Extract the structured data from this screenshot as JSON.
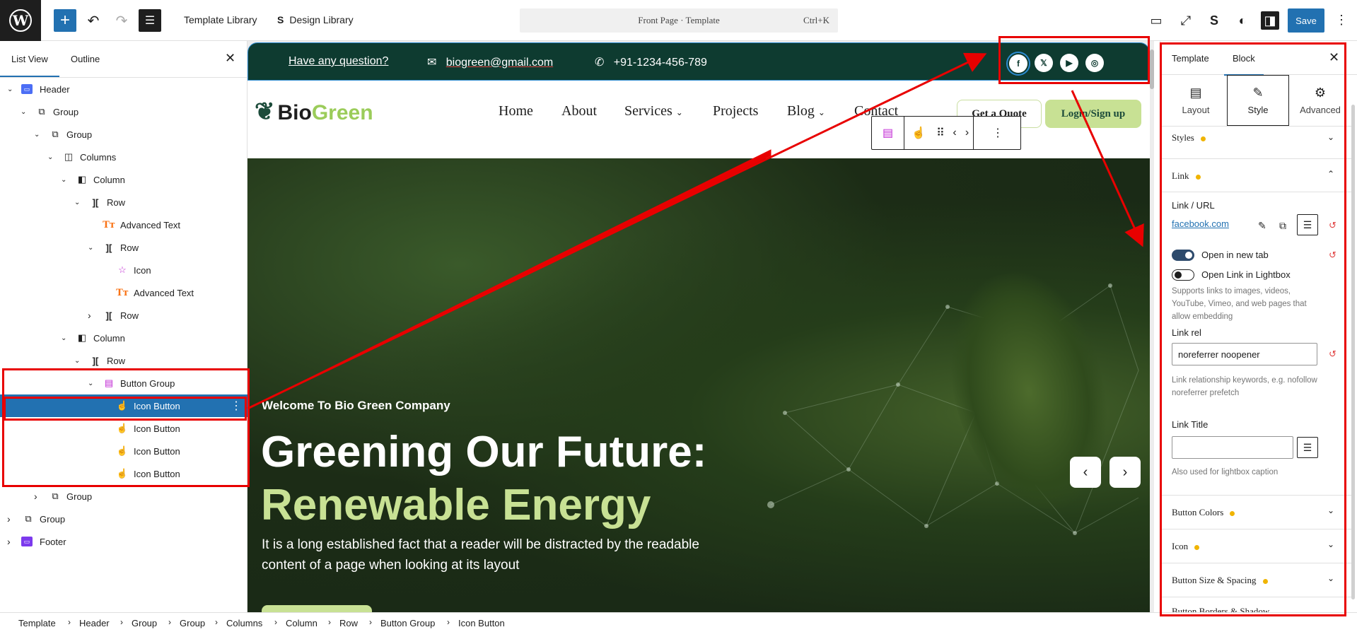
{
  "topbar": {
    "template_library": "Template Library",
    "design_library": "Design Library",
    "command_title": "Front Page · Template",
    "command_shortcut": "Ctrl+K",
    "save": "Save"
  },
  "left_panel": {
    "tab_list_view": "List View",
    "tab_outline": "Outline",
    "tree": [
      {
        "label": "Header",
        "depth": 0,
        "chevron": "down",
        "icon": "header-icon"
      },
      {
        "label": "Group",
        "depth": 1,
        "chevron": "down",
        "icon": "group-icon"
      },
      {
        "label": "Group",
        "depth": 2,
        "chevron": "down",
        "icon": "group-icon"
      },
      {
        "label": "Columns",
        "depth": 3,
        "chevron": "down",
        "icon": "columns-icon"
      },
      {
        "label": "Column",
        "depth": 4,
        "chevron": "down",
        "icon": "column-icon"
      },
      {
        "label": "Row",
        "depth": 5,
        "chevron": "down",
        "icon": "row-icon"
      },
      {
        "label": "Advanced Text",
        "depth": 6,
        "chevron": "",
        "icon": "advanced-text-icon"
      },
      {
        "label": "Row",
        "depth": 6,
        "chevron": "down",
        "icon": "row-icon"
      },
      {
        "label": "Icon",
        "depth": 7,
        "chevron": "",
        "icon": "star-icon"
      },
      {
        "label": "Advanced Text",
        "depth": 7,
        "chevron": "",
        "icon": "advanced-text-icon"
      },
      {
        "label": "Row",
        "depth": 6,
        "chevron": "right",
        "icon": "row-icon"
      },
      {
        "label": "Column",
        "depth": 4,
        "chevron": "down",
        "icon": "column-icon"
      },
      {
        "label": "Row",
        "depth": 5,
        "chevron": "down",
        "icon": "row-icon"
      },
      {
        "label": "Button Group",
        "depth": 6,
        "chevron": "down",
        "icon": "button-group-icon"
      },
      {
        "label": "Icon Button",
        "depth": 7,
        "chevron": "",
        "icon": "hand-pointer-icon",
        "selected": true
      },
      {
        "label": "Icon Button",
        "depth": 7,
        "chevron": "",
        "icon": "hand-pointer-icon"
      },
      {
        "label": "Icon Button",
        "depth": 7,
        "chevron": "",
        "icon": "hand-pointer-icon"
      },
      {
        "label": "Icon Button",
        "depth": 7,
        "chevron": "",
        "icon": "hand-pointer-icon"
      },
      {
        "label": "Group",
        "depth": 2,
        "chevron": "right",
        "icon": "group-icon"
      },
      {
        "label": "Group",
        "depth": 0,
        "chevron": "right",
        "icon": "group-icon"
      },
      {
        "label": "Footer",
        "depth": 0,
        "chevron": "right",
        "icon": "footer-icon"
      }
    ]
  },
  "site": {
    "question": "Have any question?",
    "email": "biogreen@gmail.com",
    "phone": "+91-1234-456-789",
    "logo_dark": "Bio",
    "logo_light": "Green",
    "nav": [
      "Home",
      "About",
      "Services",
      "Projects",
      "Blog",
      "Contact"
    ],
    "quote": "Get a Quote",
    "login": "Login/Sign up",
    "hero_welcome": "Welcome To Bio Green Company",
    "hero_line1": "Greening Our Future:",
    "hero_line2": "Renewable Energy",
    "hero_body": "It is a long established fact that a reader will be distracted by the readable content of a page when looking at its layout",
    "colors": {
      "topbar_bg": "#0e3b30",
      "accent_green": "#c8e194",
      "wp_blue": "#2271b1"
    }
  },
  "right_panel": {
    "tab_template": "Template",
    "tab_block": "Block",
    "subtab_layout": "Layout",
    "subtab_style": "Style",
    "subtab_advanced": "Advanced",
    "styles": "Styles",
    "link_section": "Link",
    "link_url_label": "Link / URL",
    "link_url": "facebook.com",
    "open_new_tab": "Open in new tab",
    "open_lightbox": "Open Link in Lightbox",
    "lightbox_help": "Supports links to images, videos, YouTube, Vimeo, and web pages that allow embedding",
    "link_rel_label": "Link rel",
    "link_rel_value": "noreferrer noopener",
    "link_rel_help": "Link relationship keywords, e.g. nofollow noreferrer prefetch",
    "link_title_label": "Link Title",
    "link_title_value": "",
    "link_title_help": "Also used for lightbox caption",
    "button_colors": "Button Colors",
    "icon": "Icon",
    "button_size_spacing": "Button Size & Spacing",
    "button_borders": "Button Borders & Shadow"
  },
  "breadcrumb": [
    "Template",
    "Header",
    "Group",
    "Group",
    "Columns",
    "Column",
    "Row",
    "Button Group",
    "Icon Button"
  ]
}
